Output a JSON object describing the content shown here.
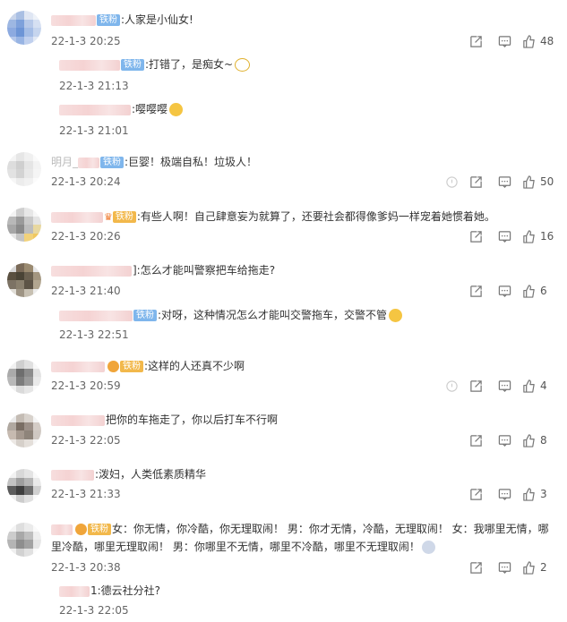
{
  "comments": [
    {
      "badge": "铁粉",
      "text": ":人家是小仙女!",
      "date": "22-1-3 20:25",
      "likes": "48"
    },
    {
      "badge": "铁粉",
      "text": ":打错了，是痴女~",
      "date": "22-1-3 21:13"
    },
    {
      "text": ":嘤嘤嘤",
      "date": "22-1-3 21:01"
    },
    {
      "name_fragment": "明月_",
      "badge": "铁粉",
      "text": ":巨婴！极端自私！垃圾人！",
      "date": "22-1-3 20:24",
      "likes": "50"
    },
    {
      "badge": "铁粉",
      "text": ":有些人啊！自己肆意妄为就算了，还要社会都得像爹妈一样宠着她惯着她。",
      "date": "22-1-3 20:26",
      "likes": "16"
    },
    {
      "text": "]:怎么才能叫警察把车给拖走?",
      "date": "22-1-3 21:40",
      "likes": "6"
    },
    {
      "badge": "铁粉",
      "text": ":对呀，这种情况怎么才能叫交警拖车，交警不管",
      "date": "22-1-3 22:51"
    },
    {
      "badge": "铁粉",
      "text": ":这样的人还真不少啊",
      "date": "22-1-3 20:59",
      "likes": "4"
    },
    {
      "text": "把你的车拖走了，你以后打车不行啊",
      "date": "22-1-3 22:05",
      "likes": "8"
    },
    {
      "text": ":泼妇，人类低素质精华",
      "date": "22-1-3 21:33",
      "likes": "3"
    },
    {
      "badge": "铁粉",
      "text_line1": "女：你无情，你冷酷，你无理取闹！ 男：你才无情，冷酷，无理取闹！ 女：我哪里无情，哪",
      "text_line2": "里冷酷，哪里无理取闹！ 男：你哪里不无情，哪里不冷酷，哪里不无理取闹！",
      "date": "22-1-3 20:38",
      "likes": "2"
    },
    {
      "text": "1:德云社分社?",
      "date": "22-1-3 22:05"
    }
  ]
}
